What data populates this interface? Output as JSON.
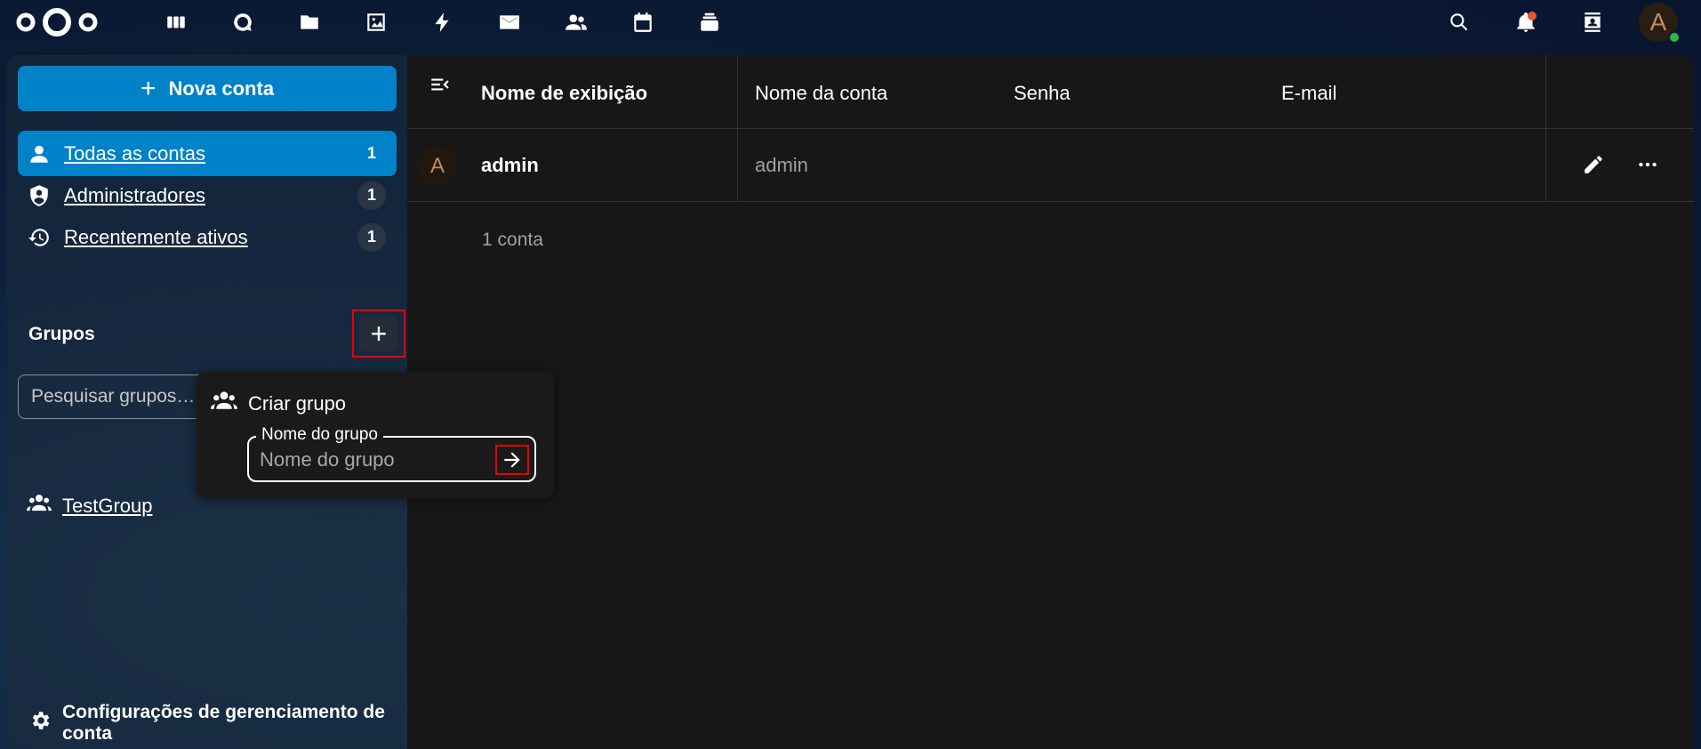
{
  "header": {
    "apps": [
      {
        "name": "dashboard-icon"
      },
      {
        "name": "talk-icon"
      },
      {
        "name": "files-icon"
      },
      {
        "name": "photos-icon"
      },
      {
        "name": "activity-icon"
      },
      {
        "name": "mail-icon"
      },
      {
        "name": "contacts-icon"
      },
      {
        "name": "calendar-icon"
      },
      {
        "name": "deck-icon"
      }
    ],
    "user_initial": "A"
  },
  "sidebar": {
    "new_account_label": "Nova conta",
    "items": [
      {
        "label": "Todas as contas",
        "count": "1",
        "icon": "user-icon",
        "active": true
      },
      {
        "label": "Administradores",
        "count": "1",
        "icon": "shield-account-icon",
        "active": false
      },
      {
        "label": "Recentemente ativos",
        "count": "1",
        "icon": "history-icon",
        "active": false
      }
    ],
    "groups_title": "Grupos",
    "add_group_label": "+",
    "group_search_placeholder": "Pesquisar grupos…",
    "groups": [
      {
        "label": "TestGroup",
        "icon": "group-icon"
      }
    ],
    "settings_label": "Configurações de gerenciamento de conta"
  },
  "popover": {
    "title": "Criar grupo",
    "field_label": "Nome do grupo",
    "field_placeholder": "Nome do grupo",
    "field_value": ""
  },
  "table": {
    "columns": [
      "Nome de exibição",
      "Nome da conta",
      "Senha",
      "E-mail"
    ],
    "rows": [
      {
        "avatar": "A",
        "display_name": "admin",
        "account_name": "admin"
      }
    ],
    "footer": "1 conta"
  },
  "colors": {
    "primary": "#0082c9",
    "background": "#171717",
    "highlight_border": "#e00000",
    "avatar_text": "#c48a5c",
    "online_status": "#2eb34d",
    "notification": "#e9552e"
  }
}
